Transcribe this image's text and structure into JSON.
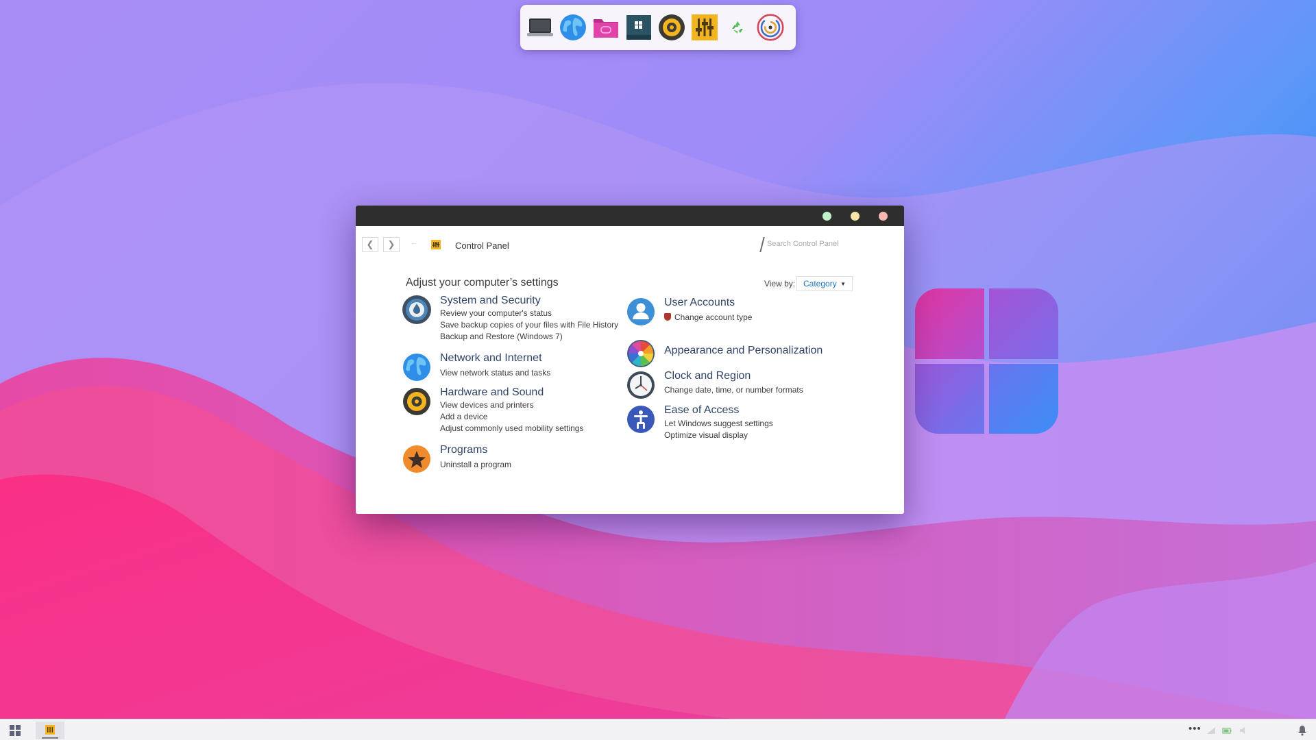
{
  "desktop": {
    "dock_icons": [
      "laptop-icon",
      "globe-icon",
      "games-folder-icon",
      "windows-terminal-icon",
      "speaker-icon",
      "equalizer-icon",
      "recycle-bin-icon",
      "settings-spiral-icon"
    ],
    "wallpaper_colors": {
      "sky_top": "#a78cf6",
      "sky_right": "#2f8ff5",
      "pink": "#f7388c",
      "magenta": "#e24aa6",
      "lavender": "#bf8ff0"
    }
  },
  "window": {
    "titlebar_buttons": [
      "minimize",
      "maximize",
      "close"
    ],
    "breadcrumb": "Control Panel",
    "search": {
      "placeholder": "Search Control Panel"
    },
    "heading": "Adjust your computer’s settings",
    "view_by": {
      "label": "View by:",
      "selected": "Category"
    },
    "categories_left": [
      {
        "title": "System and Security",
        "icon": "shield-drop-icon",
        "links": [
          "Review your computer's status",
          "Save backup copies of your files with File History",
          "Backup and Restore (Windows 7)"
        ]
      },
      {
        "title": "Network and Internet",
        "icon": "globe-icon",
        "links": [
          "View network status and tasks"
        ]
      },
      {
        "title": "Hardware and Sound",
        "icon": "speaker-icon",
        "links": [
          "View devices and printers",
          "Add a device",
          "Adjust commonly used mobility settings"
        ]
      },
      {
        "title": "Programs",
        "icon": "star-icon",
        "links": [
          "Uninstall a program"
        ]
      }
    ],
    "categories_right": [
      {
        "title": "User Accounts",
        "icon": "user-icon",
        "links": [
          "Change account type"
        ]
      },
      {
        "title": "Appearance and Personalization",
        "icon": "color-wheel-icon",
        "links": []
      },
      {
        "title": "Clock and Region",
        "icon": "clock-icon",
        "links": [
          "Change date, time, or number formats"
        ]
      },
      {
        "title": "Ease of Access",
        "icon": "accessibility-icon",
        "links": [
          "Let Windows suggest settings",
          "Optimize visual display"
        ]
      }
    ],
    "accent_colors": {
      "link": "#1e73be",
      "title": "#2f4466",
      "titlebar": "#2e2e2e"
    }
  },
  "taskbar": {
    "start_icon": "start-grid-icon",
    "pinned_app": "control-panel-icon",
    "tray": {
      "overflow": "•••",
      "icons": [
        "network-icon",
        "battery-icon",
        "volume-icon",
        "notification-bell-icon"
      ]
    }
  }
}
